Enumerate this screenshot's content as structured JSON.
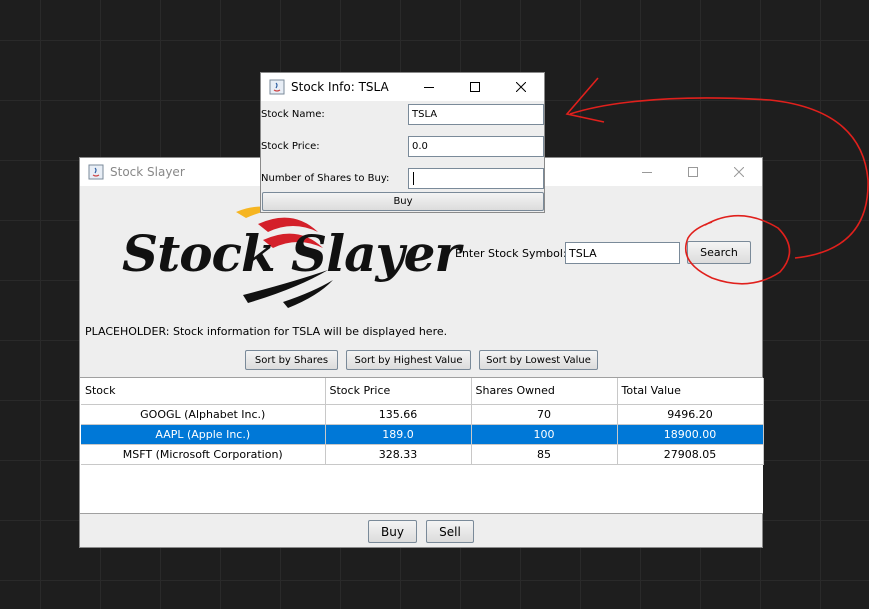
{
  "main_window": {
    "title": "Stock Slayer",
    "logo_text": "Stock Slayer",
    "search": {
      "label": "Enter Stock Symbol:",
      "value": "TSLA",
      "button": "Search"
    },
    "placeholder_text": "PLACEHOLDER: Stock information for TSLA will be displayed here.",
    "sort_buttons": [
      "Sort by Shares",
      "Sort by Highest Value",
      "Sort by Lowest Value"
    ],
    "table": {
      "columns": [
        "Stock",
        "Stock Price",
        "Shares Owned",
        "Total Value"
      ],
      "rows": [
        [
          "GOOGL (Alphabet Inc.)",
          "135.66",
          "70",
          "9496.20"
        ],
        [
          "AAPL (Apple Inc.)",
          "189.0",
          "100",
          "18900.00"
        ],
        [
          "MSFT (Microsoft Corporation)",
          "328.33",
          "85",
          "27908.05"
        ]
      ],
      "selected_row": 1
    },
    "bottom_buttons": {
      "buy": "Buy",
      "sell": "Sell"
    }
  },
  "info_dialog": {
    "title": "Stock Info: TSLA",
    "name_label": "Stock Name:",
    "name_value": "TSLA",
    "price_label": "Stock Price:",
    "price_value": "0.0",
    "shares_label": "Number of Shares to Buy:",
    "shares_value": "",
    "buy_button": "Buy"
  },
  "colors": {
    "annotation": "#e0201c",
    "selection": "#0078d7",
    "logo_red": "#d4202a",
    "logo_yellow": "#f6b521",
    "background": "#1e1e1e"
  }
}
